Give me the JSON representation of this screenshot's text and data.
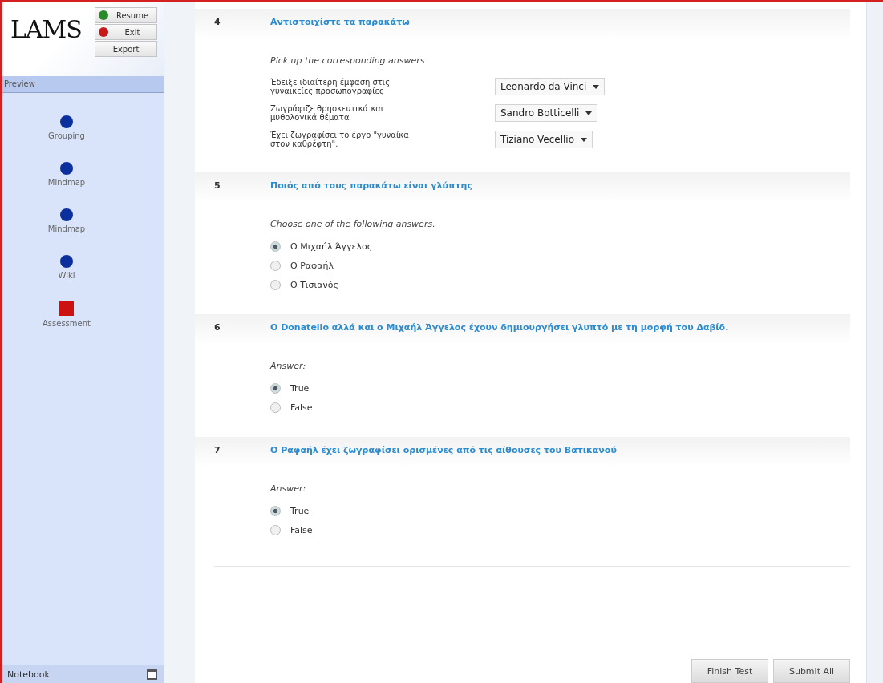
{
  "sidebar": {
    "logo": "LAMS",
    "buttons": [
      {
        "label": "Resume",
        "kind": "go"
      },
      {
        "label": "Exit",
        "kind": "stop"
      },
      {
        "label": "Export",
        "kind": "plain"
      }
    ],
    "panel_title": "Preview",
    "activities": [
      {
        "label": "Grouping",
        "kind": "circle"
      },
      {
        "label": "Mindmap",
        "kind": "circle"
      },
      {
        "label": "Mindmap",
        "kind": "circle"
      },
      {
        "label": "Wiki",
        "kind": "circle"
      },
      {
        "label": "Assessment",
        "kind": "square"
      }
    ],
    "notebook": "Notebook"
  },
  "questions": [
    {
      "number": "4",
      "title": "Αντιστοιχίστε τα παρακάτω",
      "kind": "matching",
      "instruction": "Pick up the corresponding answers",
      "pairs": [
        {
          "text": "Έδειξε ιδιαίτερη έμφαση στις γυναικείες προσωπογραφίες",
          "value": "Leonardo da Vinci"
        },
        {
          "text": "Ζωγράφιζε θρησκευτικά και μυθολογικά θέματα",
          "value": "Sandro Botticelli"
        },
        {
          "text": "Έχει ζωγραφίσει το έργο \"γυναίκα στον καθρέφτη\".",
          "value": "Tiziano Vecellio"
        }
      ]
    },
    {
      "number": "5",
      "title": "Ποιός από τους παρακάτω είναι γλύπτης",
      "kind": "choice",
      "instruction": "Choose one of the following answers.",
      "options": [
        {
          "label": "Ο Μιχαήλ Άγγελος",
          "selected": true
        },
        {
          "label": "Ο Ραφαήλ",
          "selected": false
        },
        {
          "label": "Ο Τισιανός",
          "selected": false
        }
      ]
    },
    {
      "number": "6",
      "title": "Ο Donatello αλλά και ο Μιχαήλ Άγγελος έχουν δημιουργήσει γλυπτό με τη μορφή του Δαβίδ.",
      "kind": "choice",
      "instruction": "Answer:",
      "options": [
        {
          "label": "True",
          "selected": true
        },
        {
          "label": "False",
          "selected": false
        }
      ]
    },
    {
      "number": "7",
      "title": "Ο Ραφαήλ έχει ζωγραφίσει ορισμένες από τις αίθουσες του Βατικανού",
      "kind": "choice",
      "instruction": "Answer:",
      "options": [
        {
          "label": "True",
          "selected": true
        },
        {
          "label": "False",
          "selected": false
        }
      ]
    }
  ],
  "actions": [
    "Finish Test",
    "Submit All"
  ]
}
